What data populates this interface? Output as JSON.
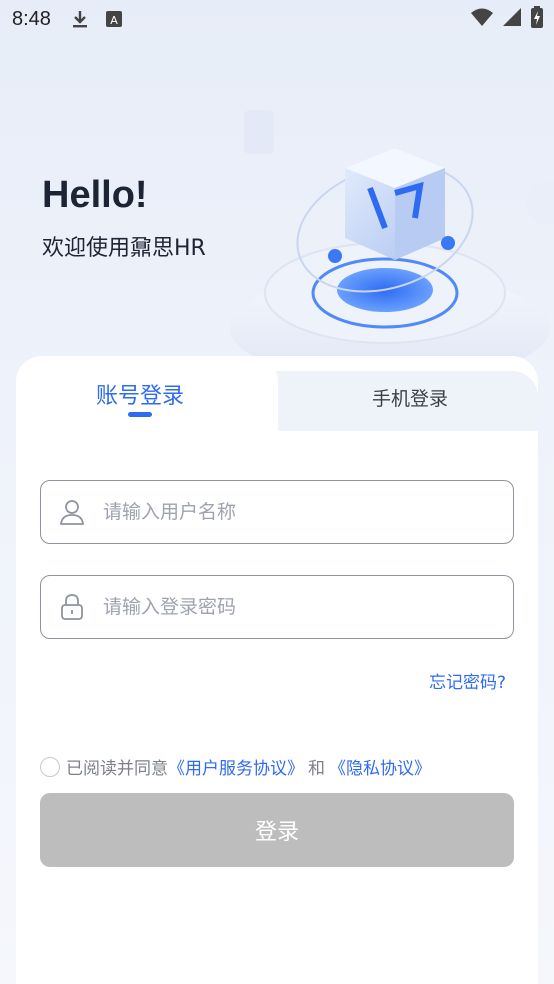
{
  "status_bar": {
    "time": "8:48",
    "icons": [
      "download-icon",
      "keyboard-a-icon",
      "wifi-icon",
      "signal-icon",
      "battery-charging-icon"
    ]
  },
  "hero": {
    "greeting": "Hello!",
    "welcome": "欢迎使用鼐思HR"
  },
  "tabs": [
    {
      "label": "账号登录",
      "active": true
    },
    {
      "label": "手机登录",
      "active": false
    }
  ],
  "form": {
    "username_placeholder": "请输入用户名称",
    "username_value": "",
    "password_placeholder": "请输入登录密码",
    "password_value": "",
    "forgot_password": "忘记密码?"
  },
  "agreement": {
    "checked": false,
    "prefix": "已阅读并同意",
    "terms_link": "《用户服务协议》",
    "conjunction": "和",
    "privacy_link": "《隐私协议》"
  },
  "login_button": "登录",
  "colors": {
    "accent": "#2f6bf2",
    "button_disabled": "#bdbdbd"
  }
}
